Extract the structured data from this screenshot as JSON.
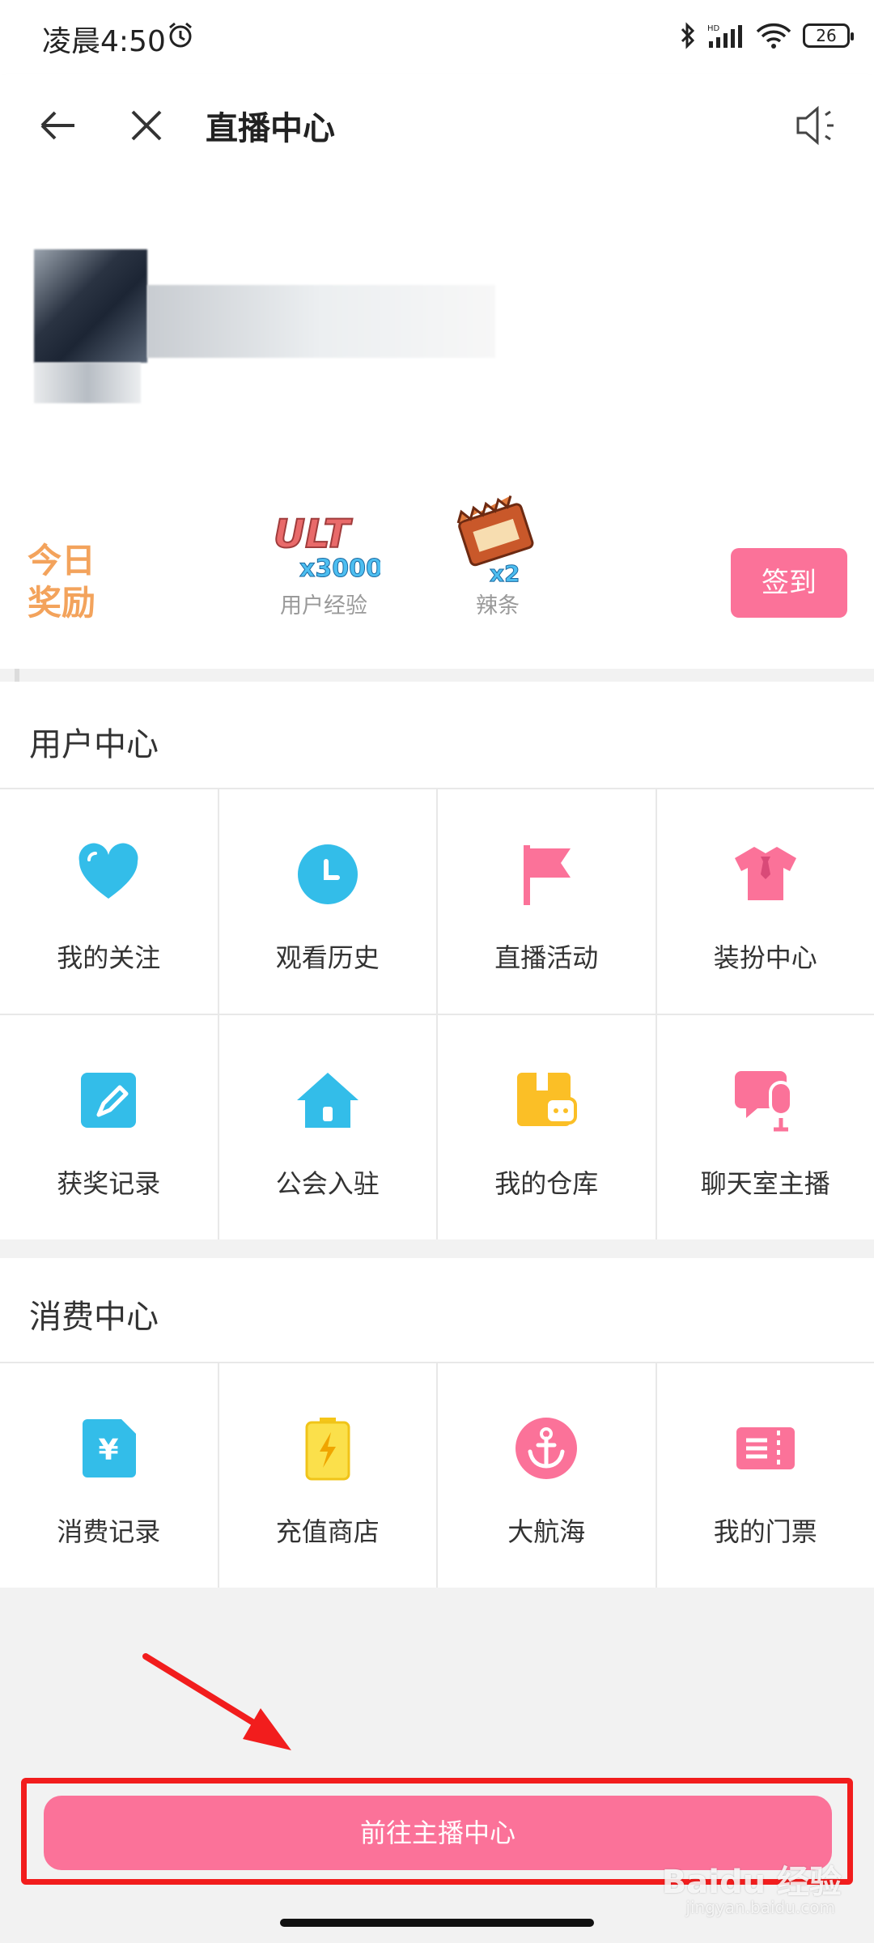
{
  "status": {
    "time": "凌晨4:50",
    "battery": "26"
  },
  "nav": {
    "title": "直播中心"
  },
  "reward": {
    "today_label": "今日奖励",
    "items": [
      {
        "badge": "ULT",
        "qty": "x3000",
        "label": "用户经验"
      },
      {
        "qty": "x2",
        "label": "辣条"
      }
    ],
    "checkin_label": "签到"
  },
  "user_center": {
    "title": "用户中心",
    "items": [
      {
        "label": "我的关注",
        "icon": "heart-icon",
        "color": "#33bde9"
      },
      {
        "label": "观看历史",
        "icon": "clock-icon",
        "color": "#33bde9"
      },
      {
        "label": "直播活动",
        "icon": "flag-icon",
        "color": "#fb7299"
      },
      {
        "label": "装扮中心",
        "icon": "shirt-icon",
        "color": "#fb7299"
      },
      {
        "label": "获奖记录",
        "icon": "edit-icon",
        "color": "#33bde9"
      },
      {
        "label": "公会入驻",
        "icon": "house-icon",
        "color": "#33bde9"
      },
      {
        "label": "我的仓库",
        "icon": "box-icon",
        "color": "#fbbf26"
      },
      {
        "label": "聊天室主播",
        "icon": "mic-chat-icon",
        "color": "#fb7299"
      }
    ]
  },
  "consume_center": {
    "title": "消费中心",
    "items": [
      {
        "label": "消费记录",
        "icon": "yuan-icon",
        "color": "#33bde9"
      },
      {
        "label": "充值商店",
        "icon": "battery-charge-icon",
        "color": "#fbe04b"
      },
      {
        "label": "大航海",
        "icon": "anchor-icon",
        "color": "#fb7299"
      },
      {
        "label": "我的门票",
        "icon": "ticket-icon",
        "color": "#fb7299"
      }
    ]
  },
  "bottom": {
    "go_label": "前往主播中心"
  },
  "watermark": {
    "main": "Baidu 经验",
    "sub": "jingyan.baidu.com"
  },
  "colors": {
    "accent": "#fb7299",
    "blue": "#33bde9",
    "highlight": "#f21d1d"
  }
}
